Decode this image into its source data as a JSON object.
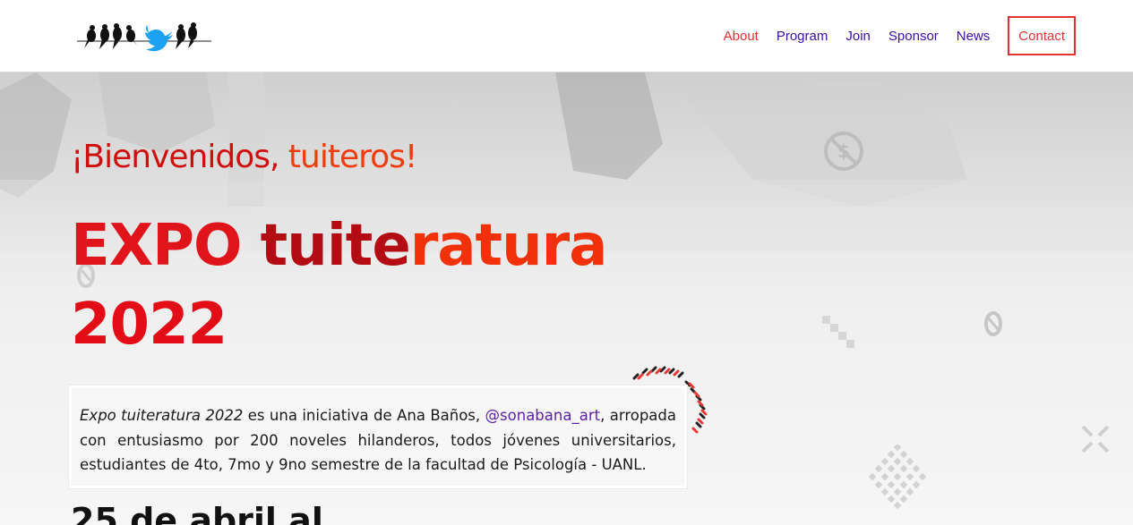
{
  "logo": {
    "icon": "birds-on-wire-twitter-logo"
  },
  "nav": {
    "items": [
      {
        "label": "About",
        "color": "#e0322f"
      },
      {
        "label": "Program",
        "color": "#3d0ea8"
      },
      {
        "label": "Join",
        "color": "#3d0ea8"
      },
      {
        "label": "Sponsor",
        "color": "#3d0ea8"
      },
      {
        "label": "News",
        "color": "#3d0ea8"
      },
      {
        "label": "Contact",
        "color": "#e0322f"
      }
    ]
  },
  "hero": {
    "welcome_part1": "¡Bienvenidos,",
    "welcome_part2": "tuiteros!",
    "title_word1": "EXPO",
    "title_word2a": "tuite",
    "title_word2b": "ratura",
    "title_line2": "2022",
    "intro": {
      "em_text": "Expo tuiteratura 2022",
      "text1": " es una iniciativa de Ana Baños, ",
      "handle": "@sonabana_art",
      "text2": ", arropada con entusiasmo por 200 noveles hilanderos, todos jóvenes universitarios, estudiantes de 4to, 7mo y 9no semestre de la facultad de Psicología - UANL."
    },
    "date_partial": "25 de abril al"
  },
  "colors": {
    "accent_red": "#e0322f",
    "nav_purple": "#3d0ea8",
    "title_red": "#e0141b",
    "title_orange": "#f2300a"
  }
}
